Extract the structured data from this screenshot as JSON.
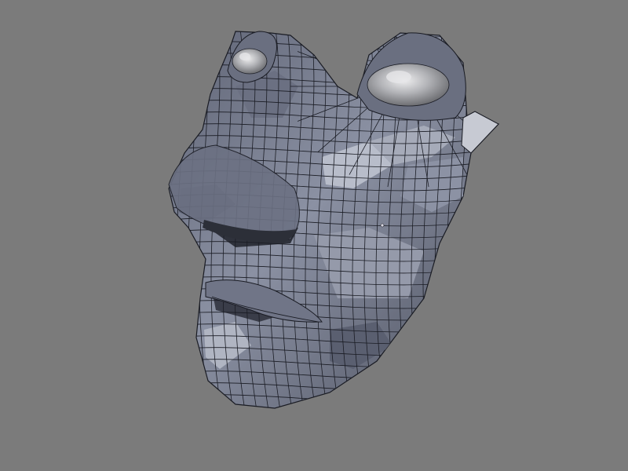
{
  "viewport": {
    "background_color": "#7b7b7b",
    "content": "3d-wireframe-head-mesh"
  },
  "mesh": {
    "face_color": "#7f8596",
    "shadow_color": "#3d404d",
    "highlight_color": "#c3c7d3",
    "wire_color": "#1a1c24",
    "eye_color": "#a8a9ad",
    "eye_highlight_color": "#e6e6e8"
  },
  "cursor": {
    "icon": "3d-cursor-icon"
  }
}
